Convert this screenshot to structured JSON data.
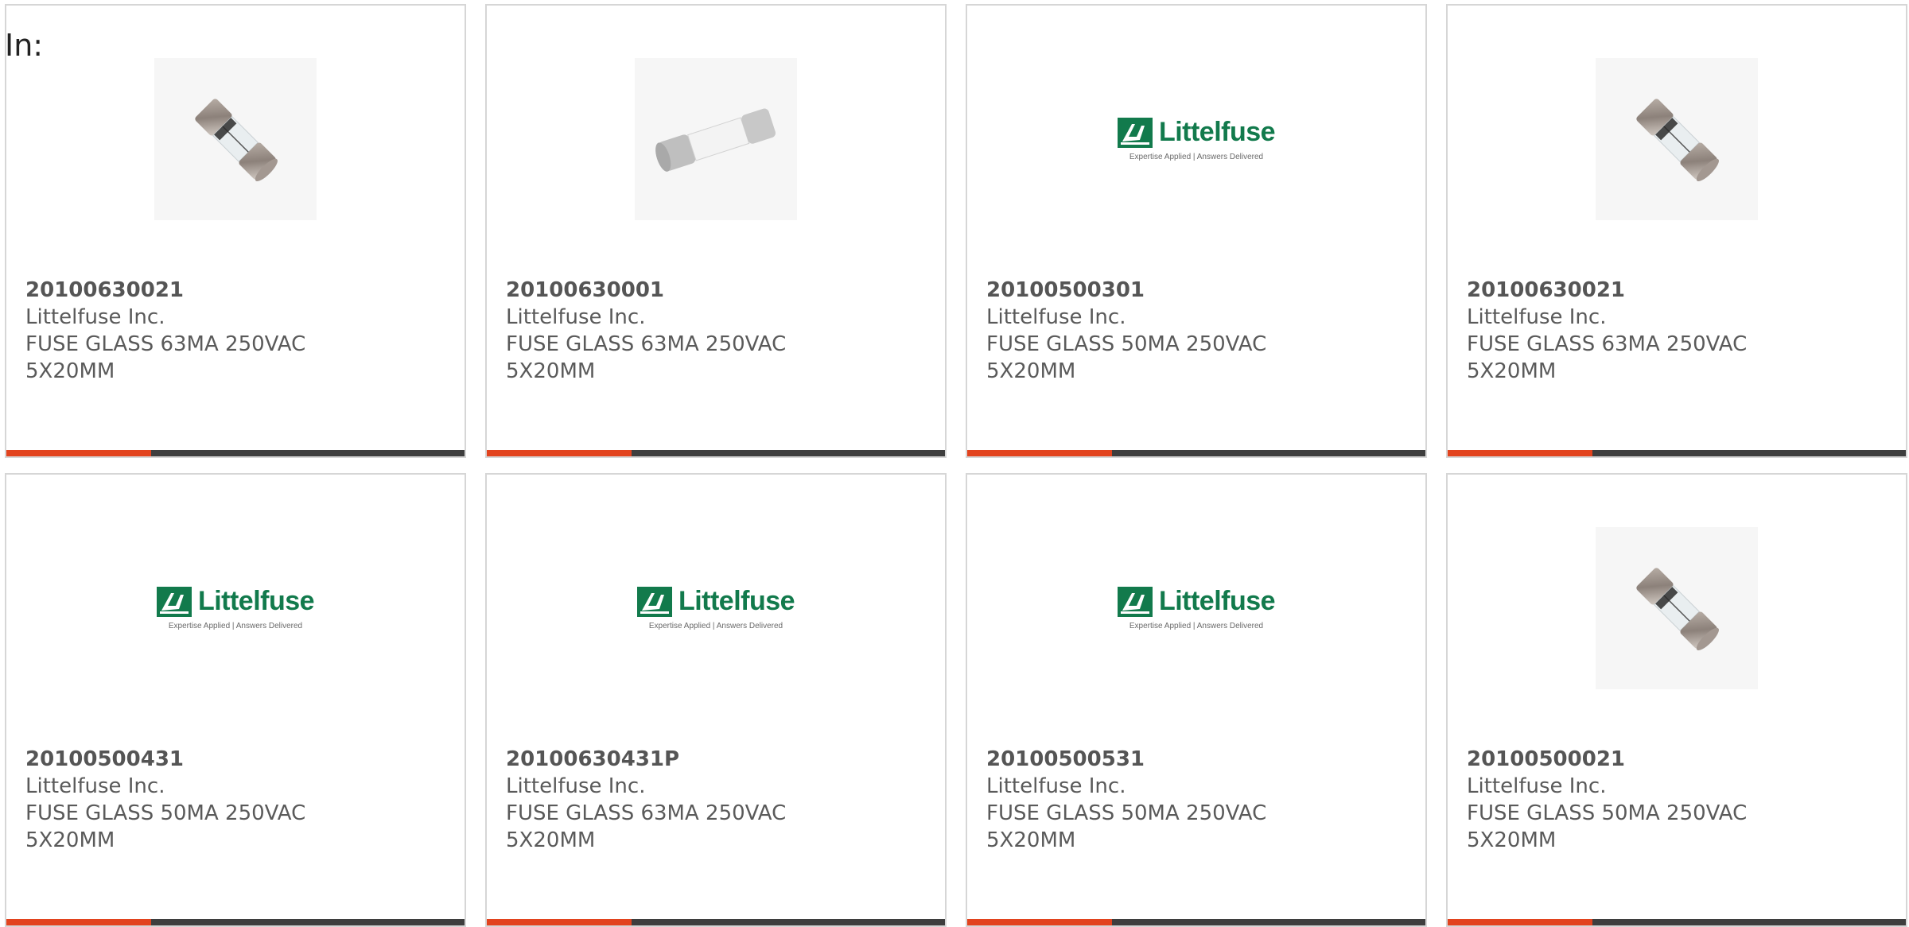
{
  "filter": {
    "label": "In:"
  },
  "brand": {
    "logo_text": "Littelfuse",
    "tagline": "Expertise Applied | Answers Delivered",
    "logo_color": "#127a4c"
  },
  "colors": {
    "accent": "#e2431e",
    "bar": "#3e3e3e"
  },
  "products": [
    {
      "part_number": "20100630021",
      "manufacturer": "Littelfuse Inc.",
      "description": "FUSE GLASS 63MA 250VAC 5X20MM",
      "image": "fuse-photo"
    },
    {
      "part_number": "20100630001",
      "manufacturer": "Littelfuse Inc.",
      "description": "FUSE GLASS 63MA 250VAC 5X20MM",
      "image": "fuse-render"
    },
    {
      "part_number": "20100500301",
      "manufacturer": "Littelfuse Inc.",
      "description": "FUSE GLASS 50MA 250VAC 5X20MM",
      "image": "littelfuse-logo"
    },
    {
      "part_number": "20100630021",
      "manufacturer": "Littelfuse Inc.",
      "description": "FUSE GLASS 63MA 250VAC 5X20MM",
      "image": "fuse-photo"
    },
    {
      "part_number": "20100500431",
      "manufacturer": "Littelfuse Inc.",
      "description": "FUSE GLASS 50MA 250VAC 5X20MM",
      "image": "littelfuse-logo"
    },
    {
      "part_number": "20100630431P",
      "manufacturer": "Littelfuse Inc.",
      "description": "FUSE GLASS 63MA 250VAC 5X20MM",
      "image": "littelfuse-logo"
    },
    {
      "part_number": "20100500531",
      "manufacturer": "Littelfuse Inc.",
      "description": "FUSE GLASS 50MA 250VAC 5X20MM",
      "image": "littelfuse-logo"
    },
    {
      "part_number": "20100500021",
      "manufacturer": "Littelfuse Inc.",
      "description": "FUSE GLASS 50MA 250VAC 5X20MM",
      "image": "fuse-photo"
    }
  ]
}
